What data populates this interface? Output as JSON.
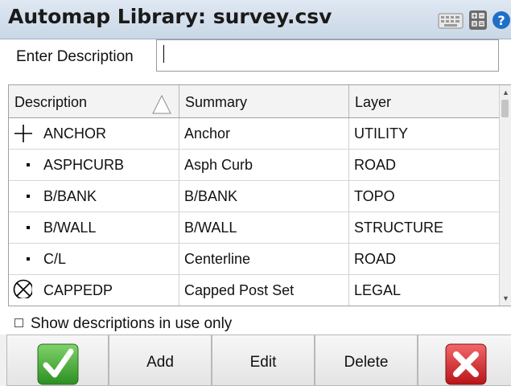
{
  "titlebar": {
    "title": "Automap Library: survey.csv",
    "icons": [
      "keyboard-icon",
      "calculator-icon",
      "help-icon"
    ],
    "help_glyph": "?"
  },
  "description": {
    "label": "Enter Description",
    "value": "",
    "placeholder": ""
  },
  "table": {
    "columns": [
      "Description",
      "Summary",
      "Layer"
    ],
    "sort_column": "Description",
    "sort_direction": "ascending",
    "rows": [
      {
        "symbol": "plus-symbol",
        "description": "ANCHOR",
        "summary": "Anchor",
        "layer": "UTILITY"
      },
      {
        "symbol": "dot-symbol",
        "description": "ASPHCURB",
        "summary": "Asph Curb",
        "layer": "ROAD"
      },
      {
        "symbol": "dot-symbol",
        "description": "B/BANK",
        "summary": "B/BANK",
        "layer": "TOPO"
      },
      {
        "symbol": "dot-symbol",
        "description": "B/WALL",
        "summary": "B/WALL",
        "layer": "STRUCTURE"
      },
      {
        "symbol": "dot-symbol",
        "description": "C/L",
        "summary": "Centerline",
        "layer": "ROAD"
      },
      {
        "symbol": "circle-x-symbol",
        "description": "CAPPEDP",
        "summary": "Capped Post Set",
        "layer": "LEGAL"
      }
    ]
  },
  "options": {
    "show_in_use_label": "Show descriptions in use only",
    "show_in_use_checked": false
  },
  "buttons": {
    "ok_icon": "checkmark-icon",
    "add": "Add",
    "edit": "Edit",
    "delete": "Delete",
    "cancel_icon": "red-x-icon"
  },
  "colors": {
    "ok_green": "#3cae2e",
    "cancel_red": "#d9252a",
    "help_blue": "#1e6fc8"
  }
}
